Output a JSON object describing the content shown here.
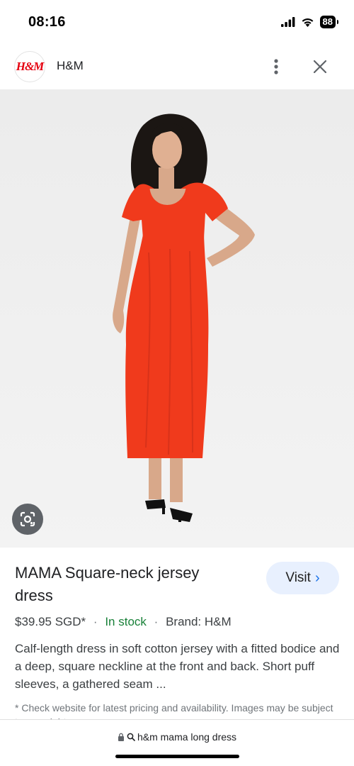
{
  "status_bar": {
    "time": "08:16",
    "battery": "88"
  },
  "header": {
    "logo_text": "H&M",
    "site_name": "H&M"
  },
  "product": {
    "title": "MAMA Square-neck jersey dress",
    "visit_label": "Visit",
    "price": "$39.95 SGD*",
    "stock": "In stock",
    "brand": "Brand: H&M",
    "description": "Calf-length dress in soft cotton jersey with a fitted bodice and a deep, square neckline at the front and back. Short puff sleeves, a gathered seam ...",
    "note": "* Check website for latest pricing and availability. Images may be subject to copyright."
  },
  "url_bar": {
    "query": "h&m mama long dress"
  },
  "icons": {
    "signal": "signal-icon",
    "wifi": "wifi-icon",
    "battery": "battery-icon",
    "menu": "more-vert-icon",
    "close": "close-icon",
    "lens": "google-lens-icon",
    "visit": "chevron-right-icon",
    "lock": "lock-icon",
    "search": "search-icon"
  },
  "colors": {
    "accent": "#1a73e8",
    "stock": "#188038",
    "brand": "#e50010",
    "dress": "#f03a1c"
  }
}
